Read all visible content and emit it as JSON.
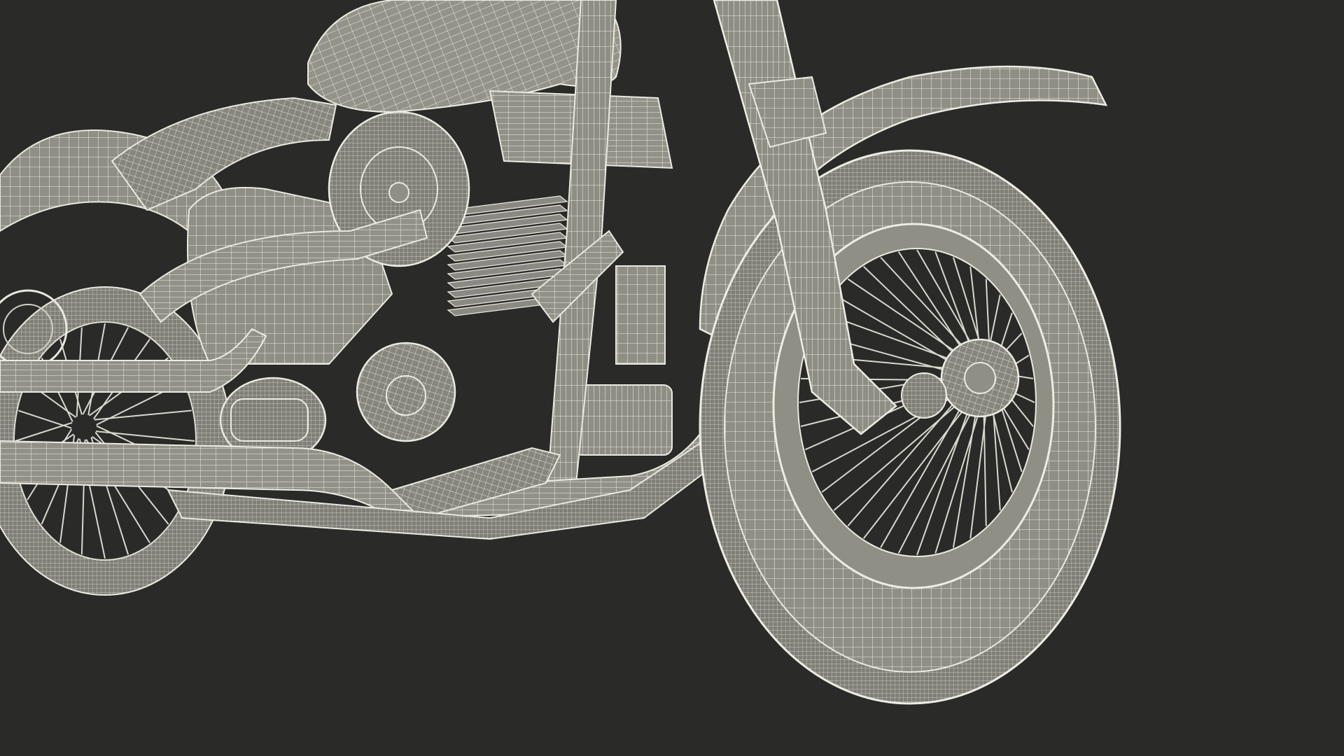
{
  "scene": {
    "subject": "motorcycle-wireframe-render",
    "colors": {
      "background": "#2a2a29",
      "surface": "#8f8f86",
      "surface_light": "#a8a89e",
      "surface_dark": "#6e6e66",
      "wire": "#e9e9df",
      "wire_dim": "#cfcfc4",
      "shadow": "#1e1e1d"
    },
    "front_wheel": {
      "spoke_count": 40
    },
    "rear_wheel": {
      "spoke_count": 24
    }
  }
}
